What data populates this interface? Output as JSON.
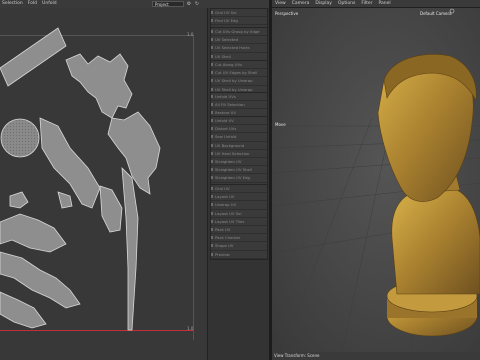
{
  "app": {
    "menu": [
      "Selection",
      "Fold",
      "Unfold"
    ],
    "project_dropdown": "Project"
  },
  "uv_editor": {
    "tick_top_right": "1.0",
    "tick_bottom_right": "1.0"
  },
  "tools": {
    "groups": [
      [
        "Grid UV Sel",
        "Find UV Edg",
        "Flip UV Edg"
      ],
      [
        "Cut UVs Group by Edge",
        "UV Selected",
        "UV Selected Holes",
        "UV Shell"
      ],
      [
        "Cut Along UVs",
        "Cut UV Edges by Shell",
        "UV Shell by Unwrap",
        "UV Shell by Unwrap"
      ],
      [
        "Unfold UVs",
        "All Fill Selection",
        "Restore UV"
      ],
      [
        "Unfold UV",
        "Distort UVs",
        "Sew Unfold",
        "UV Background",
        "UV Hard Selection",
        "Straighten UV",
        "Straighten UV Shell",
        "Straighten UV Edg",
        "Straighten UV Layout"
      ],
      [
        "Grid UV",
        "Layout UV",
        "Unwrap UV",
        "Layout UV Sel",
        "Layout UV Tiles",
        "Pack UV",
        "Pack Checker",
        "Shape UV",
        "Preview"
      ]
    ]
  },
  "viewport": {
    "menu": [
      "View",
      "Camera",
      "Display",
      "Options",
      "Filter",
      "Panel"
    ],
    "label_view": "Perspective",
    "label_camera": "Default Camera",
    "label_mode": "Move",
    "status": "View Transform: Scene"
  }
}
